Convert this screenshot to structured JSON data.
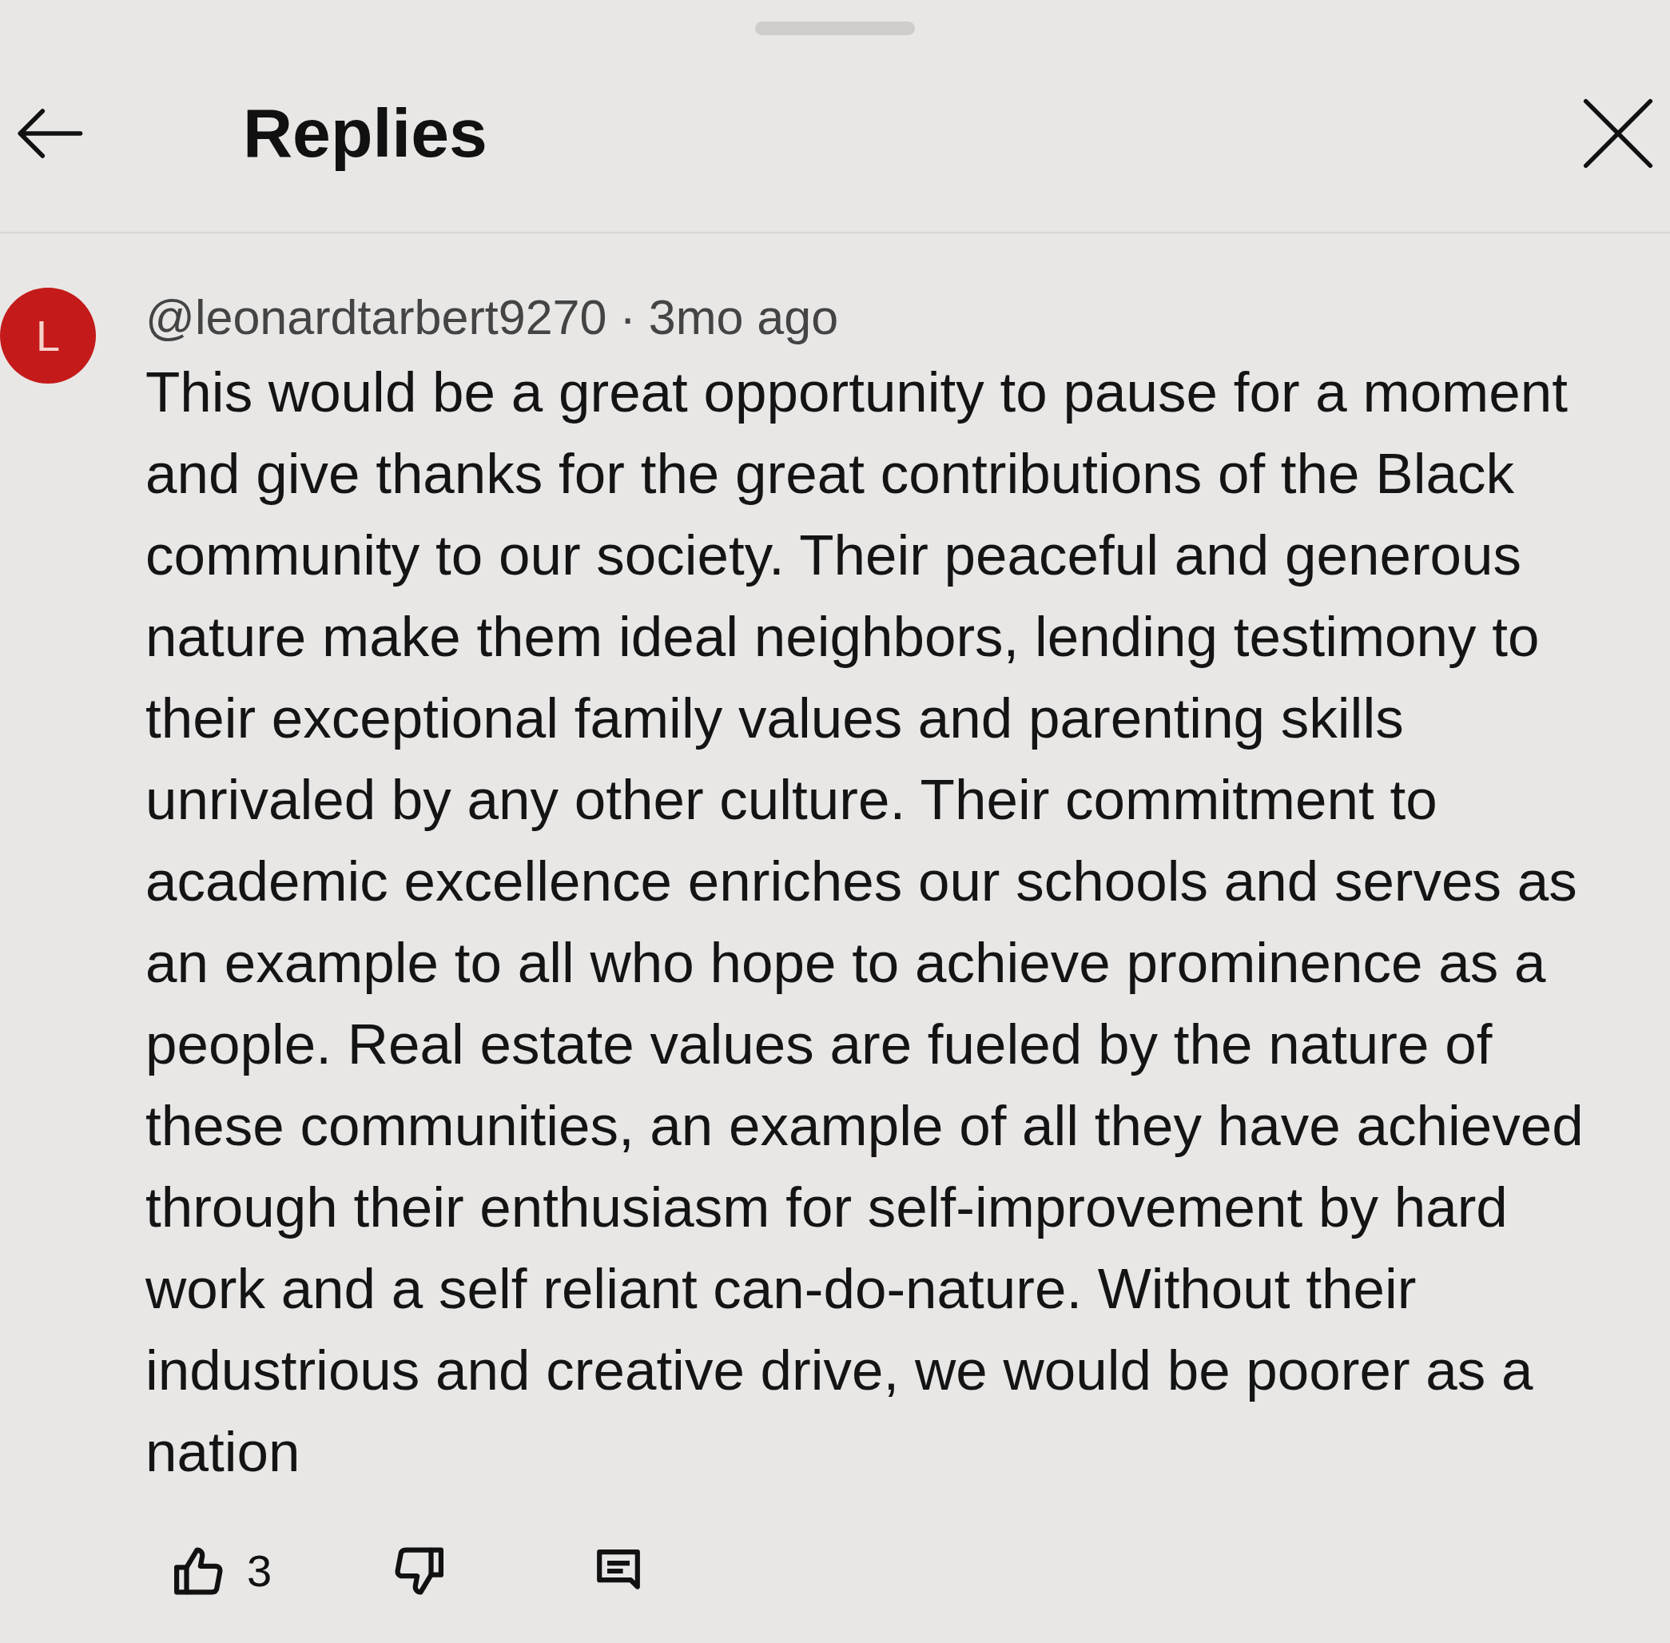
{
  "sheet": {
    "title": "Replies"
  },
  "comment": {
    "avatar_letter": "L",
    "author": "@leonardtarbert9270",
    "separator": "·",
    "time": "3mo ago",
    "text": "This would be a great opportunity to pause for a moment and give thanks for the great contributions of the Black community to our society. Their peaceful and generous nature make them ideal neighbors, lending testimony to their exceptional family values and parenting skills unrivaled by any other culture. Their commitment to academic excellence enriches our schools and serves as an example to all who hope to achieve prominence as a people. Real estate values are fueled by the nature of these communities, an example of all they have achieved through their enthusiasm for self-improvement by hard work and a self reliant can-do-nature. Without their industrious and creative drive, we would be poorer as a nation",
    "likes": "3"
  }
}
